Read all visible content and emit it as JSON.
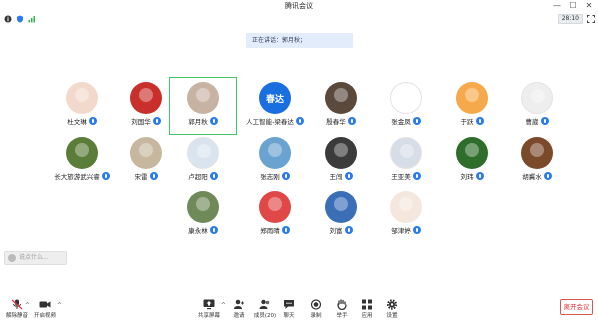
{
  "window": {
    "title": "腾讯会议",
    "minimize": "—",
    "maximize": "☐",
    "close": "✕"
  },
  "status": {
    "timer": "28:10"
  },
  "speaking": {
    "text": "正在讲话：郭月秋；"
  },
  "participants": [
    {
      "name": "杜文琳",
      "avatar_color": "#f3d9cc",
      "avatar_icon": "avatar-ear-drawing"
    },
    {
      "name": "刘国华",
      "avatar_color": "#c9302c",
      "avatar_icon": "avatar-china-badge"
    },
    {
      "name": "郭月秋",
      "avatar_color": "#c8b3a3",
      "avatar_icon": "avatar-portrait-girl",
      "active": true
    },
    {
      "name": "人工智能-梁春达",
      "avatar_color": "#1a6fe0",
      "avatar_text": "春达",
      "avatar_icon": "avatar-text-chunda"
    },
    {
      "name": "殷春华",
      "avatar_color": "#5b4a3c",
      "avatar_icon": "avatar-fireworks"
    },
    {
      "name": "张金凤",
      "avatar_color": "#ffffff",
      "avatar_icon": "avatar-cartoon-character"
    },
    {
      "name": "于跃",
      "avatar_color": "#f6a94a",
      "avatar_icon": "avatar-lion"
    },
    {
      "name": "曹崴",
      "avatar_color": "#eeeeee",
      "avatar_icon": "avatar-sketch-face"
    },
    {
      "name": "长大旅游武兴睿",
      "avatar_color": "#5b7d3a",
      "avatar_icon": "avatar-palm-tree"
    },
    {
      "name": "宋雷",
      "avatar_color": "#c7b79e",
      "avatar_icon": "avatar-cat"
    },
    {
      "name": "卢超阳",
      "avatar_color": "#d9e4ef",
      "avatar_icon": "avatar-crystal"
    },
    {
      "name": "张志刚",
      "avatar_color": "#6aa3cf",
      "avatar_icon": "avatar-seascape"
    },
    {
      "name": "王闯",
      "avatar_color": "#3b3b3b",
      "avatar_icon": "avatar-man-suit"
    },
    {
      "name": "王亚美",
      "avatar_color": "#d7dde6",
      "avatar_icon": "avatar-blank"
    },
    {
      "name": "刘玮",
      "avatar_color": "#2f6d2c",
      "avatar_icon": "avatar-forest"
    },
    {
      "name": "胡冀水",
      "avatar_color": "#7a4a2b",
      "avatar_icon": "avatar-brown-creature"
    },
    {
      "name": "康永林",
      "avatar_color": "#6f8a58",
      "avatar_icon": "avatar-man-outdoor"
    },
    {
      "name": "郑雨晴",
      "avatar_color": "#e04848",
      "avatar_icon": "avatar-red-flower"
    },
    {
      "name": "刘富",
      "avatar_color": "#3a6fb8",
      "avatar_icon": "avatar-city-night"
    },
    {
      "name": "邹津婷",
      "avatar_color": "#f4e7de",
      "avatar_icon": "avatar-cartoon-girl"
    }
  ],
  "chat": {
    "placeholder": "说点什么..."
  },
  "toolbar": {
    "unmute": "解除静音",
    "video": "开启视频",
    "share": "共享屏幕",
    "invite": "邀请",
    "members": "成员(20)",
    "chat": "聊天",
    "record": "录制",
    "raise_hand": "举手",
    "apps": "应用",
    "settings": "设置",
    "leave": "离开会议"
  },
  "colors": {
    "accent": "#2a7bf0",
    "active_border": "#45c36b",
    "leave": "#e03434"
  }
}
